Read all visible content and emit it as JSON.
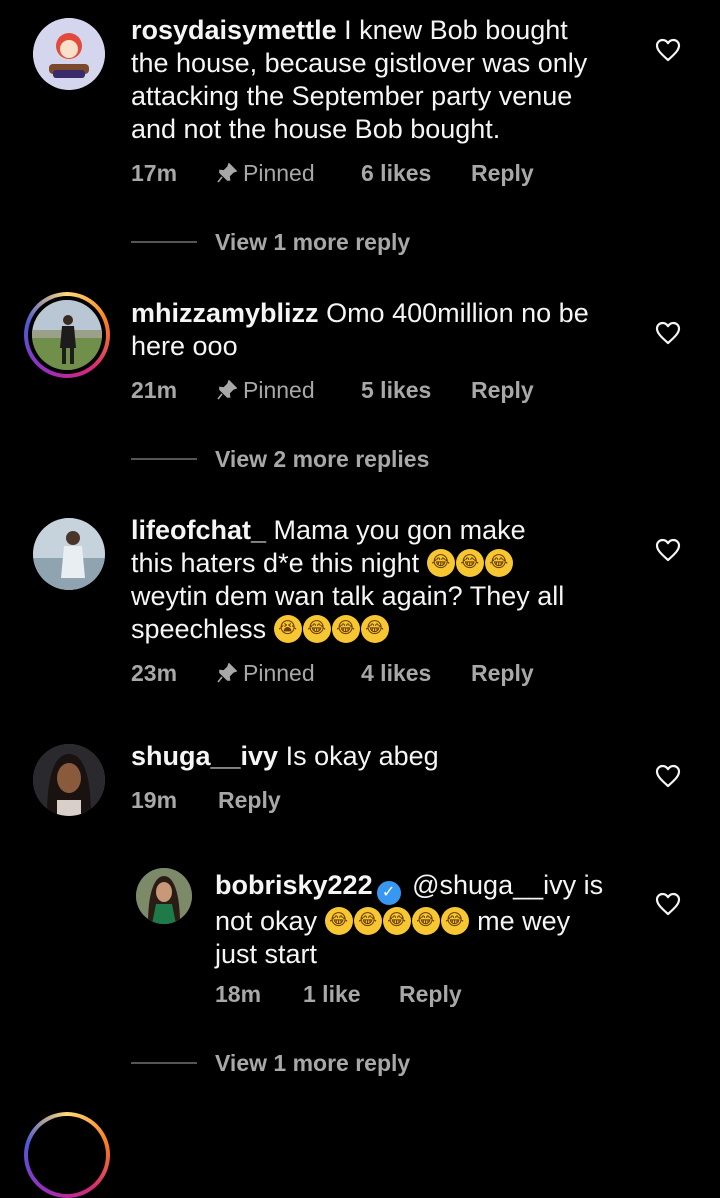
{
  "comments": [
    {
      "username": "rosydaisymettle",
      "text_lines": [
        "I knew Bob bought",
        "the house, because gistlover was only",
        "attacking the September party venue",
        "and not the house Bob bought."
      ],
      "time": "17m",
      "pinned": "Pinned",
      "likes": "6 likes",
      "reply": "Reply",
      "view_more": "View 1 more reply"
    },
    {
      "username": "mhizzamyblizz",
      "text_lines": [
        "Omo 400million no be",
        "here ooo"
      ],
      "time": "21m",
      "pinned": "Pinned",
      "likes": "5 likes",
      "reply": "Reply",
      "view_more": "View 2 more replies"
    },
    {
      "username": "lifeofchat_",
      "text_lines": [
        "Mama you gon make",
        "this haters d*e this night",
        "weytin dem wan talk again? They all",
        "speechless"
      ],
      "time": "23m",
      "pinned": "Pinned",
      "likes": "4 likes",
      "reply": "Reply"
    },
    {
      "username": "shuga__ivy",
      "text_lines": [
        "Is okay abeg"
      ],
      "time": "19m",
      "reply": "Reply"
    },
    {
      "username": "bobrisky222",
      "text_lines": [
        "@shuga__ivy is",
        "not okay",
        "me wey",
        "just start"
      ],
      "time": "18m",
      "likes": "1 like",
      "reply": "Reply",
      "view_more": "View 1 more reply"
    }
  ],
  "icons": {
    "heart": "heart-outline-icon",
    "pin": "pin-icon",
    "verified": "verified-badge-icon",
    "emoji_laugh": "tears-of-joy-emoji",
    "emoji_cry": "loudly-crying-emoji"
  },
  "colors": {
    "background": "#000000",
    "text": "#f5f5f5",
    "secondary": "#a8a8a8",
    "verified": "#3897f0"
  }
}
